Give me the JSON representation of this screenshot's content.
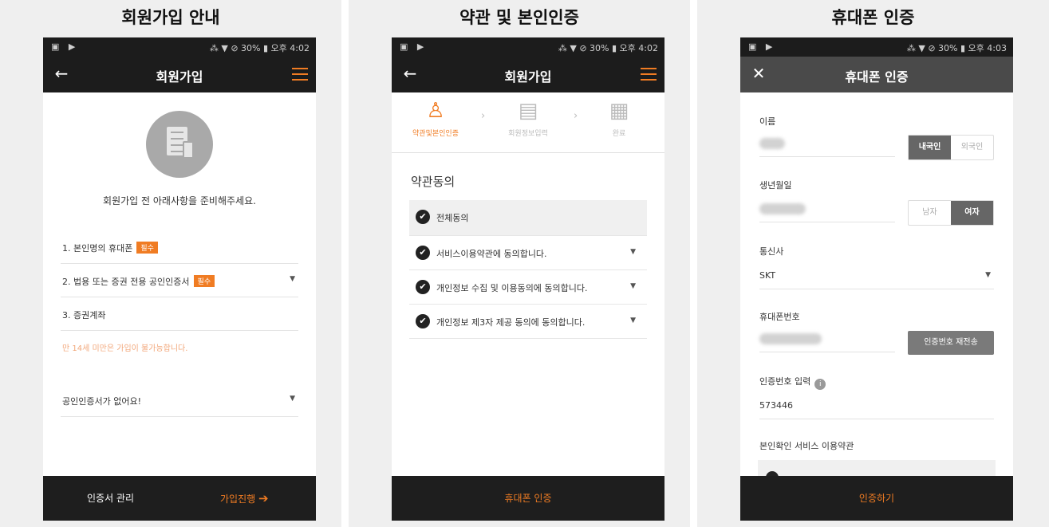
{
  "panels": [
    {
      "title": "회원가입 안내",
      "status": {
        "left": "▣ ▶",
        "right": "⁂ ▼ ⊘ 30% ▮ 오후 4:02"
      },
      "appbar": {
        "nav": "←",
        "title": "회원가입"
      },
      "intro": "회원가입 전 아래사항을 준비해주세요.",
      "requirements": [
        {
          "label": "1. 본인명의 휴대폰",
          "badge": "필수"
        },
        {
          "label": "2. 법용 또는 증권 전용 공인인증서",
          "badge": "필수"
        },
        {
          "label": "3. 증권계좌"
        }
      ],
      "note": "만 14세 미만은 가입이 불가능합니다.",
      "cert_dropdown": "공인인증서가 없어요!",
      "bottom": {
        "left": "인증서 관리",
        "right": "가입진행"
      }
    },
    {
      "title": "약관 및 본인인증",
      "status": {
        "left": "▣ ▶",
        "right": "⁂ ▼ ⊘ 30% ▮ 오후 4:02"
      },
      "appbar": {
        "nav": "←",
        "title": "회원가입"
      },
      "steps": [
        {
          "icon": "person-check-icon",
          "label": "약관및본인인증",
          "active": true
        },
        {
          "icon": "form-icon",
          "label": "회원정보입력",
          "active": false
        },
        {
          "icon": "done-icon",
          "label": "완료",
          "active": false
        }
      ],
      "agree_title": "약관동의",
      "agree_items": [
        {
          "label": "전체동의"
        },
        {
          "label": "서비스이용약관에 동의합니다."
        },
        {
          "label": "개인정보 수집 및 이용동의에 동의합니다."
        },
        {
          "label": "개인정보 제3자 제공 동의에 동의합니다."
        }
      ],
      "bottom": {
        "center": "휴대폰 인증"
      }
    },
    {
      "title": "휴대폰 인증",
      "status": {
        "left": "▣ ▶",
        "right": "⁂ ▼ ⊘ 30% ▮ 오후 4:03"
      },
      "appbar": {
        "nav": "✕",
        "title": "휴대폰 인증"
      },
      "fields": {
        "name_label": "이름",
        "nationality": [
          "내국인",
          "외국인"
        ],
        "birth_label": "생년월일",
        "gender": [
          "남자",
          "여자"
        ],
        "carrier_label": "통신사",
        "carrier_value": "SKT",
        "phone_label": "휴대폰번호",
        "resend": "인증번호 재전송",
        "code_label": "인증번호 입력",
        "code_value": "573446",
        "terms_label": "본인확인 서비스 이용약관"
      },
      "bottom": {
        "center": "인증하기"
      }
    }
  ],
  "colors": {
    "accent": "#f07c23",
    "bar": "#1c1c1c"
  }
}
